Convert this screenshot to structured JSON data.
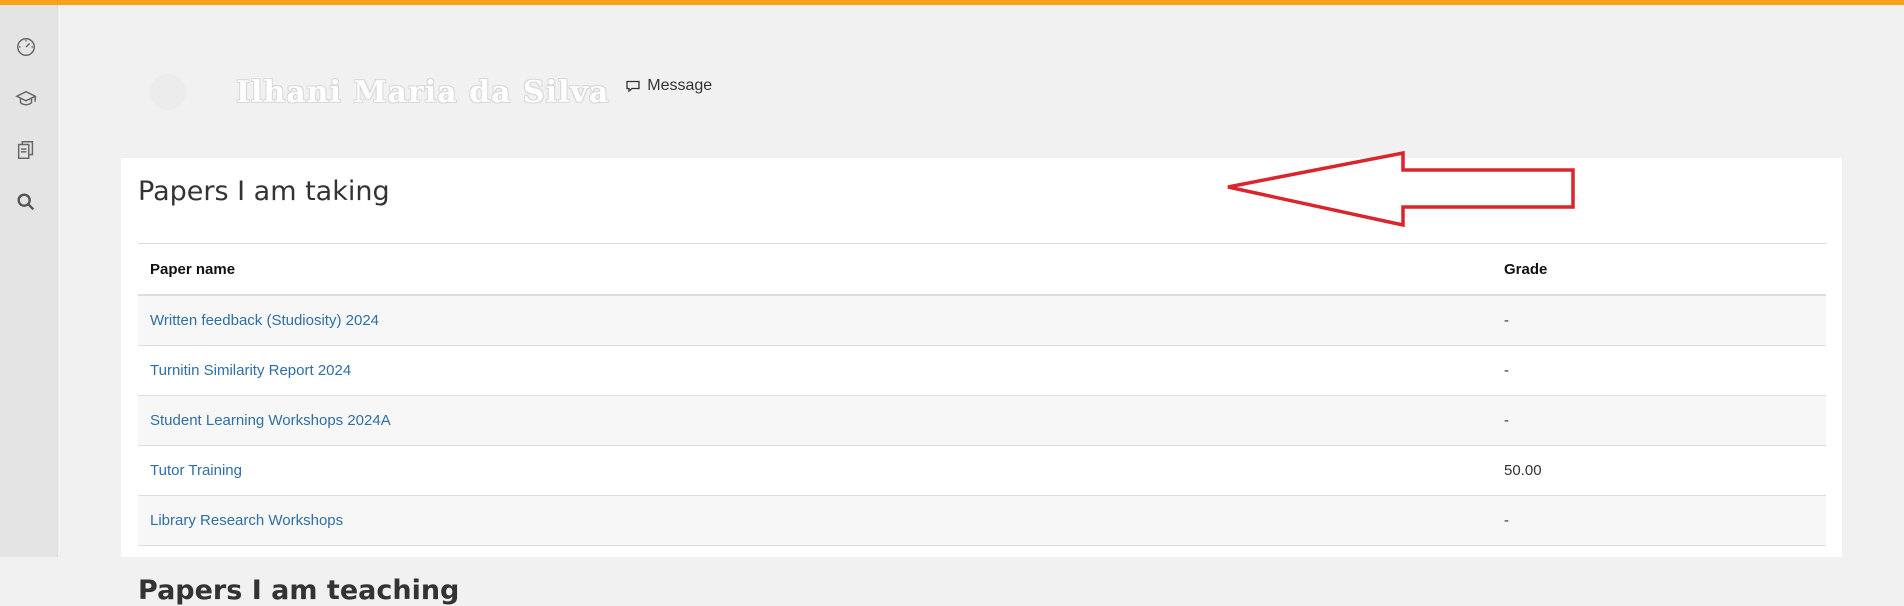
{
  "colors": {
    "accent_bar": "#f7a21b",
    "link": "#2f6fa3",
    "annotation": "#d9252b"
  },
  "sidebar": {
    "items": [
      {
        "icon": "dashboard-gauge-icon"
      },
      {
        "icon": "graduation-cap-icon"
      },
      {
        "icon": "documents-icon"
      },
      {
        "icon": "search-icon"
      }
    ]
  },
  "profile": {
    "name": "Ilhani Maria da Silva",
    "message_label": "Message"
  },
  "papers_card": {
    "title": "Papers I am taking",
    "columns": [
      "Paper name",
      "Grade"
    ],
    "rows": [
      {
        "name": "Written feedback (Studiosity) 2024",
        "grade": "-"
      },
      {
        "name": "Turnitin Similarity Report 2024",
        "grade": "-"
      },
      {
        "name": "Student Learning Workshops 2024A",
        "grade": "-"
      },
      {
        "name": "Tutor Training",
        "grade": "50.00"
      },
      {
        "name": "Library Research Workshops",
        "grade": "-"
      }
    ]
  },
  "next_section": {
    "title": "Papers I am teaching"
  },
  "annotation": {
    "icon": "red-left-arrow-annotation"
  }
}
